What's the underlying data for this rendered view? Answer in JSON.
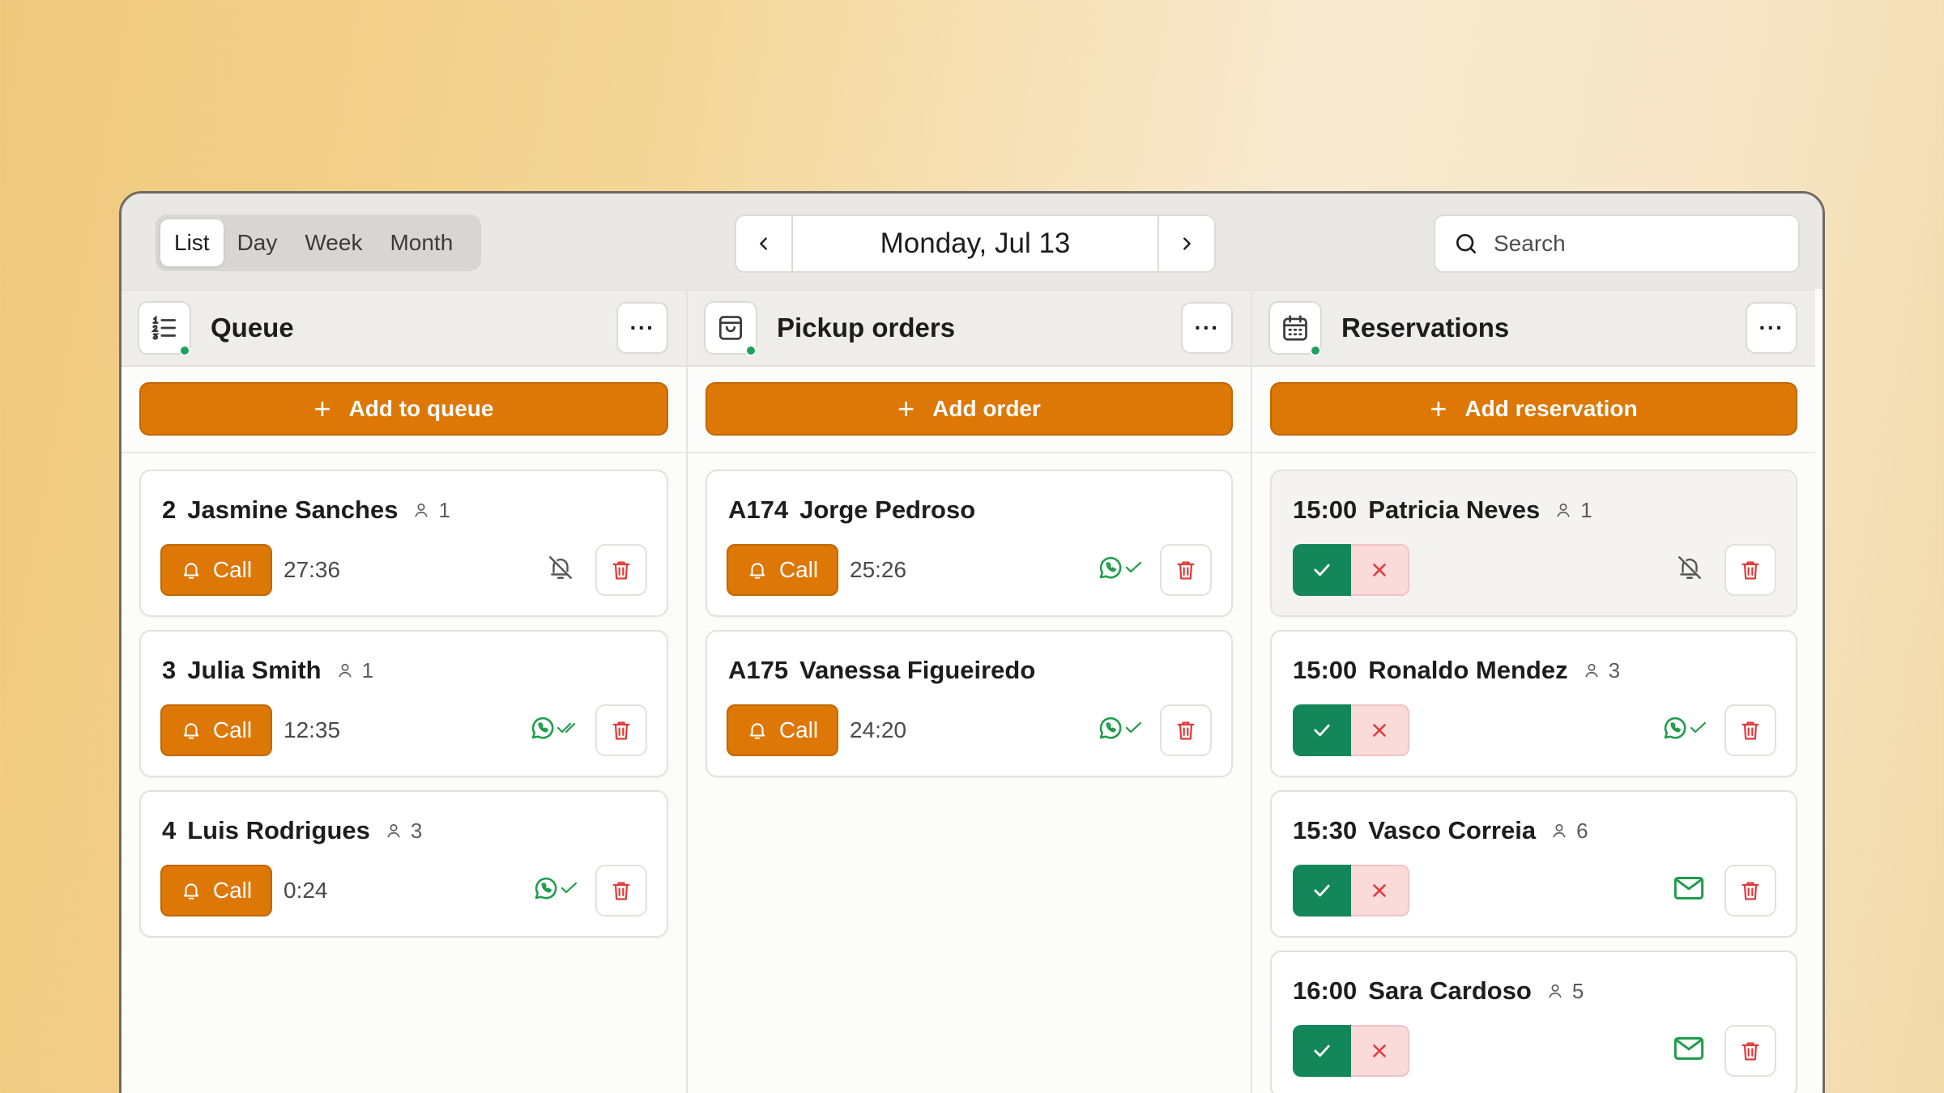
{
  "view_tabs": {
    "list": "List",
    "day": "Day",
    "week": "Week",
    "month": "Month"
  },
  "date_nav": {
    "label": "Monday, Jul 13"
  },
  "search": {
    "placeholder": "Search"
  },
  "queue": {
    "title": "Queue",
    "add_label": "Add to queue",
    "items": [
      {
        "number": "2",
        "name": "Jasmine Sanches",
        "party": "1",
        "call_label": "Call",
        "timer": "27:36",
        "status": "bell-off-icon"
      },
      {
        "number": "3",
        "name": "Julia Smith",
        "party": "1",
        "call_label": "Call",
        "timer": "12:35",
        "status": "whatsapp-read-icon"
      },
      {
        "number": "4",
        "name": "Luis Rodrigues",
        "party": "3",
        "call_label": "Call",
        "timer": "0:24",
        "status": "whatsapp-delivered-icon"
      }
    ]
  },
  "pickup": {
    "title": "Pickup orders",
    "add_label": "Add order",
    "items": [
      {
        "number": "A174",
        "name": "Jorge Pedroso",
        "call_label": "Call",
        "timer": "25:26",
        "status": "whatsapp-delivered-icon"
      },
      {
        "number": "A175",
        "name": "Vanessa Figueiredo",
        "call_label": "Call",
        "timer": "24:20",
        "status": "whatsapp-delivered-icon"
      }
    ]
  },
  "reservations": {
    "title": "Reservations",
    "add_label": "Add reservation",
    "items": [
      {
        "time": "15:00",
        "name": "Patricia Neves",
        "party": "1",
        "status": "bell-off-icon"
      },
      {
        "time": "15:00",
        "name": "Ronaldo Mendez",
        "party": "3",
        "status": "whatsapp-delivered-icon"
      },
      {
        "time": "15:30",
        "name": "Vasco Correia",
        "party": "6",
        "status": "mail-icon"
      },
      {
        "time": "16:00",
        "name": "Sara Cardoso",
        "party": "5",
        "status": "mail-icon"
      }
    ]
  },
  "colors": {
    "accent": "#dd7706",
    "accept": "#14875a",
    "online_dot": "#1da25a",
    "delete": "#e03b3b",
    "whatsapp": "#1e9c4b"
  }
}
